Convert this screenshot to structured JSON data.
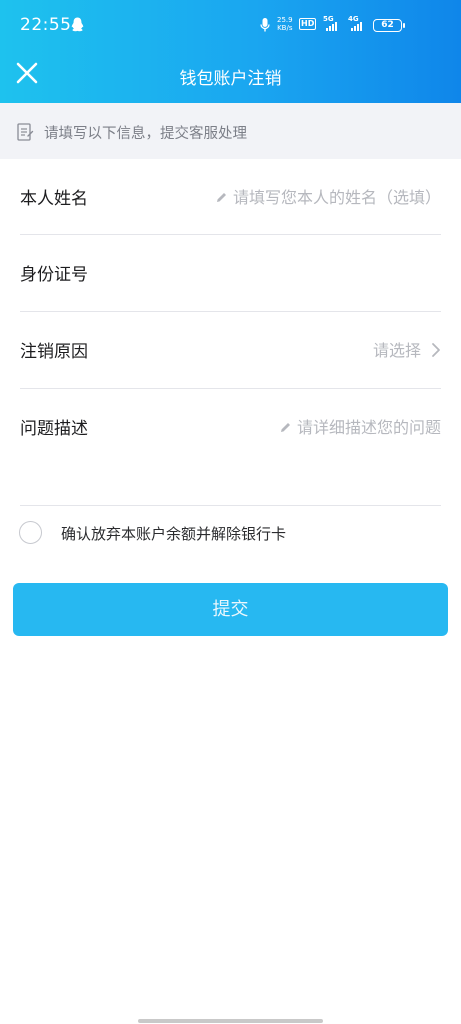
{
  "status_bar": {
    "time": "22:55",
    "net_speed_value": "25.9",
    "net_speed_unit": "KB/s",
    "hd_label": "HD",
    "sig1_label": "5G",
    "sig2_label": "4G",
    "battery": "62"
  },
  "nav": {
    "title": "钱包账户注销",
    "close_icon": "close-icon"
  },
  "notice": {
    "icon": "form-icon",
    "text": "请填写以下信息，提交客服处理"
  },
  "form": {
    "name": {
      "label": "本人姓名",
      "placeholder": "请填写您本人的姓名（选填）"
    },
    "id_number": {
      "label": "身份证号",
      "value": ""
    },
    "reason": {
      "label": "注销原因",
      "hint": "请选择"
    },
    "description": {
      "label": "问题描述",
      "placeholder": "请详细描述您的问题"
    }
  },
  "consent": {
    "text": "确认放弃本账户余额并解除银行卡",
    "checked": false
  },
  "submit": {
    "label": "提交"
  },
  "colors": {
    "header_start": "#1ec2ee",
    "header_end": "#0f86ea",
    "button": "#27b8f1",
    "notice_bg": "#f2f3f7"
  }
}
